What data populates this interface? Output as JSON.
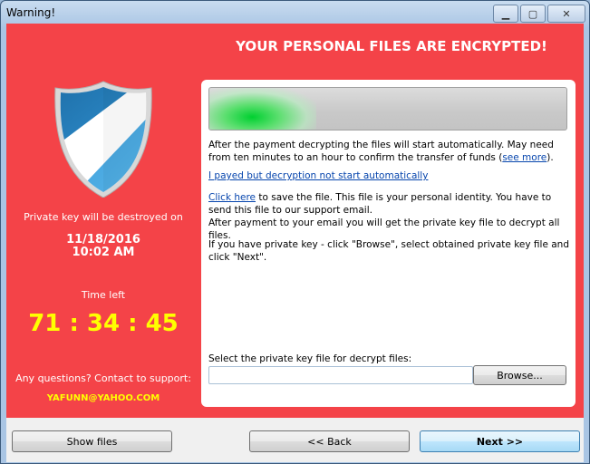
{
  "window": {
    "title": "Warning!",
    "controls": {
      "minimize": "minimize-icon",
      "maximize": "maximize-icon",
      "close": "close-icon"
    },
    "controls_glyphs": {
      "minimize": "▁",
      "maximize": "▢",
      "close": "✕"
    }
  },
  "header": {
    "headline": "YOUR PERSONAL FILES ARE ENCRYPTED!"
  },
  "colors": {
    "background": "#f44348",
    "accent_yellow": "#ffff00",
    "link": "#0645ad",
    "progress_green": "#00d030"
  },
  "left": {
    "shield_icon": "shield-icon",
    "destroy_label": "Private key will be destroyed on",
    "destroy_date": "11/18/2016",
    "destroy_time": "10:02 AM",
    "time_left_label": "Time left",
    "timer": "71 : 34 : 45",
    "support_label": "Any questions? Contact to support:",
    "support_email": "YAFUNN@YAHOO.COM"
  },
  "panel": {
    "progress_fraction": 0.3,
    "p1_text": "After the payment decrypting the files will start automatically. May need from ten minutes to an hour to confirm the transfer of funds (",
    "p1_link": "see more",
    "p1_end": ").",
    "link_payed": "I payed but decryption not start automatically",
    "p3_link": "Click here",
    "p3_text": " to save the file. This file is your personal identity. You have to send this file to our support email.",
    "p3_line2": "After payment to your email you will get the private key file to decrypt all files.",
    "p4_text": "If you have private key - click \"Browse\", select obtained private key file and click \"Next\".",
    "file_label": "Select the private key file for decrypt files:",
    "file_value": "",
    "browse_label": "Browse..."
  },
  "footer": {
    "show_files": "Show files",
    "back": "<< Back",
    "next": "Next >>"
  }
}
